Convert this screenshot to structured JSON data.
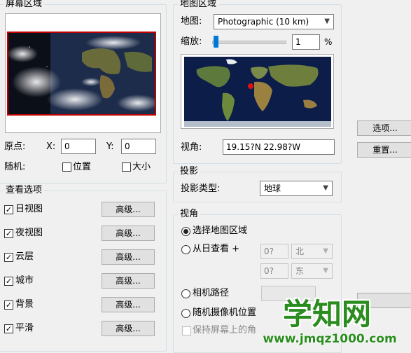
{
  "screen_area": {
    "title": "屏幕区域",
    "origin_label": "原点:",
    "x_label": "X:",
    "x_value": "0",
    "y_label": "Y:",
    "y_value": "0",
    "random_label": "随机:",
    "position_label": "位置",
    "size_label": "大小"
  },
  "view_options": {
    "title": "查看选项",
    "more_label": "高级...",
    "items": [
      {
        "label": "日视图",
        "checked": true
      },
      {
        "label": "夜视图",
        "checked": true
      },
      {
        "label": "云层",
        "checked": true
      },
      {
        "label": "城市",
        "checked": true
      },
      {
        "label": "背景",
        "checked": true
      },
      {
        "label": "平滑",
        "checked": true
      }
    ]
  },
  "map_area": {
    "title": "地图区域",
    "map_label": "地图:",
    "map_value": "Photographic (10 km)",
    "zoom_label": "缩放:",
    "zoom_value": "1",
    "zoom_unit": "%",
    "zoom_level": 0.02,
    "view_label": "视角:",
    "view_value": "19.15?N   22.98?W"
  },
  "projection": {
    "title": "投影",
    "type_label": "投影类型:",
    "type_value": "地球"
  },
  "viewpoint": {
    "title": "视角",
    "select_map_label": "选择地图区域",
    "from_sun_label": "从日查看 +",
    "lat_value": "0?",
    "lat_dir": "北",
    "lon_value": "0?",
    "lon_dir": "东",
    "camera_path_label": "相机路径",
    "camera_path_button": "",
    "random_camera_label": "随机摄像机位置",
    "keep_screen_label": "保持屏幕上的角"
  },
  "side_buttons": {
    "options": "选项...",
    "reset": "重置..."
  },
  "watermark": {
    "brand": "学知网",
    "url": "www.jmqz1000.com"
  }
}
